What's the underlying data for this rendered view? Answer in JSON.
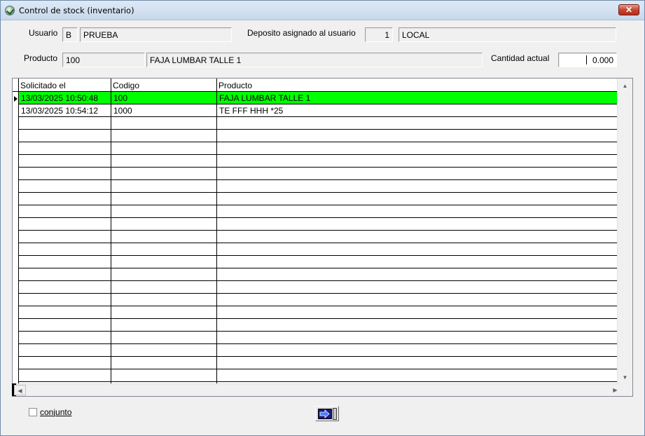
{
  "window": {
    "title": "Control de stock (inventario)",
    "close_label": "✕"
  },
  "header": {
    "usuario_label": "Usuario",
    "usuario_code": "B",
    "usuario_name": "PRUEBA",
    "deposito_label": "Deposito asignado al usuario",
    "deposito_code": "1",
    "deposito_name": "LOCAL",
    "producto_label": "Producto",
    "producto_code": "100",
    "producto_name": "FAJA LUMBAR TALLE 1",
    "cantidad_label": "Cantidad actual",
    "cantidad_value": "0.000"
  },
  "grid": {
    "columns": [
      "Solicitado el",
      "Codigo",
      "Producto"
    ],
    "rows": [
      {
        "solicitado": "13/03/2025 10:50:48",
        "codigo": "100",
        "producto": "FAJA LUMBAR TALLE 1",
        "selected": true
      },
      {
        "solicitado": "13/03/2025 10:54:12",
        "codigo": "1000",
        "producto": "TE FFF HHH *25",
        "selected": false
      }
    ],
    "selected_color": "#00ff00"
  },
  "footer": {
    "conjunto_label": "conjunto",
    "conjunto_checked": false,
    "exit_icon": "exit-door-icon"
  }
}
